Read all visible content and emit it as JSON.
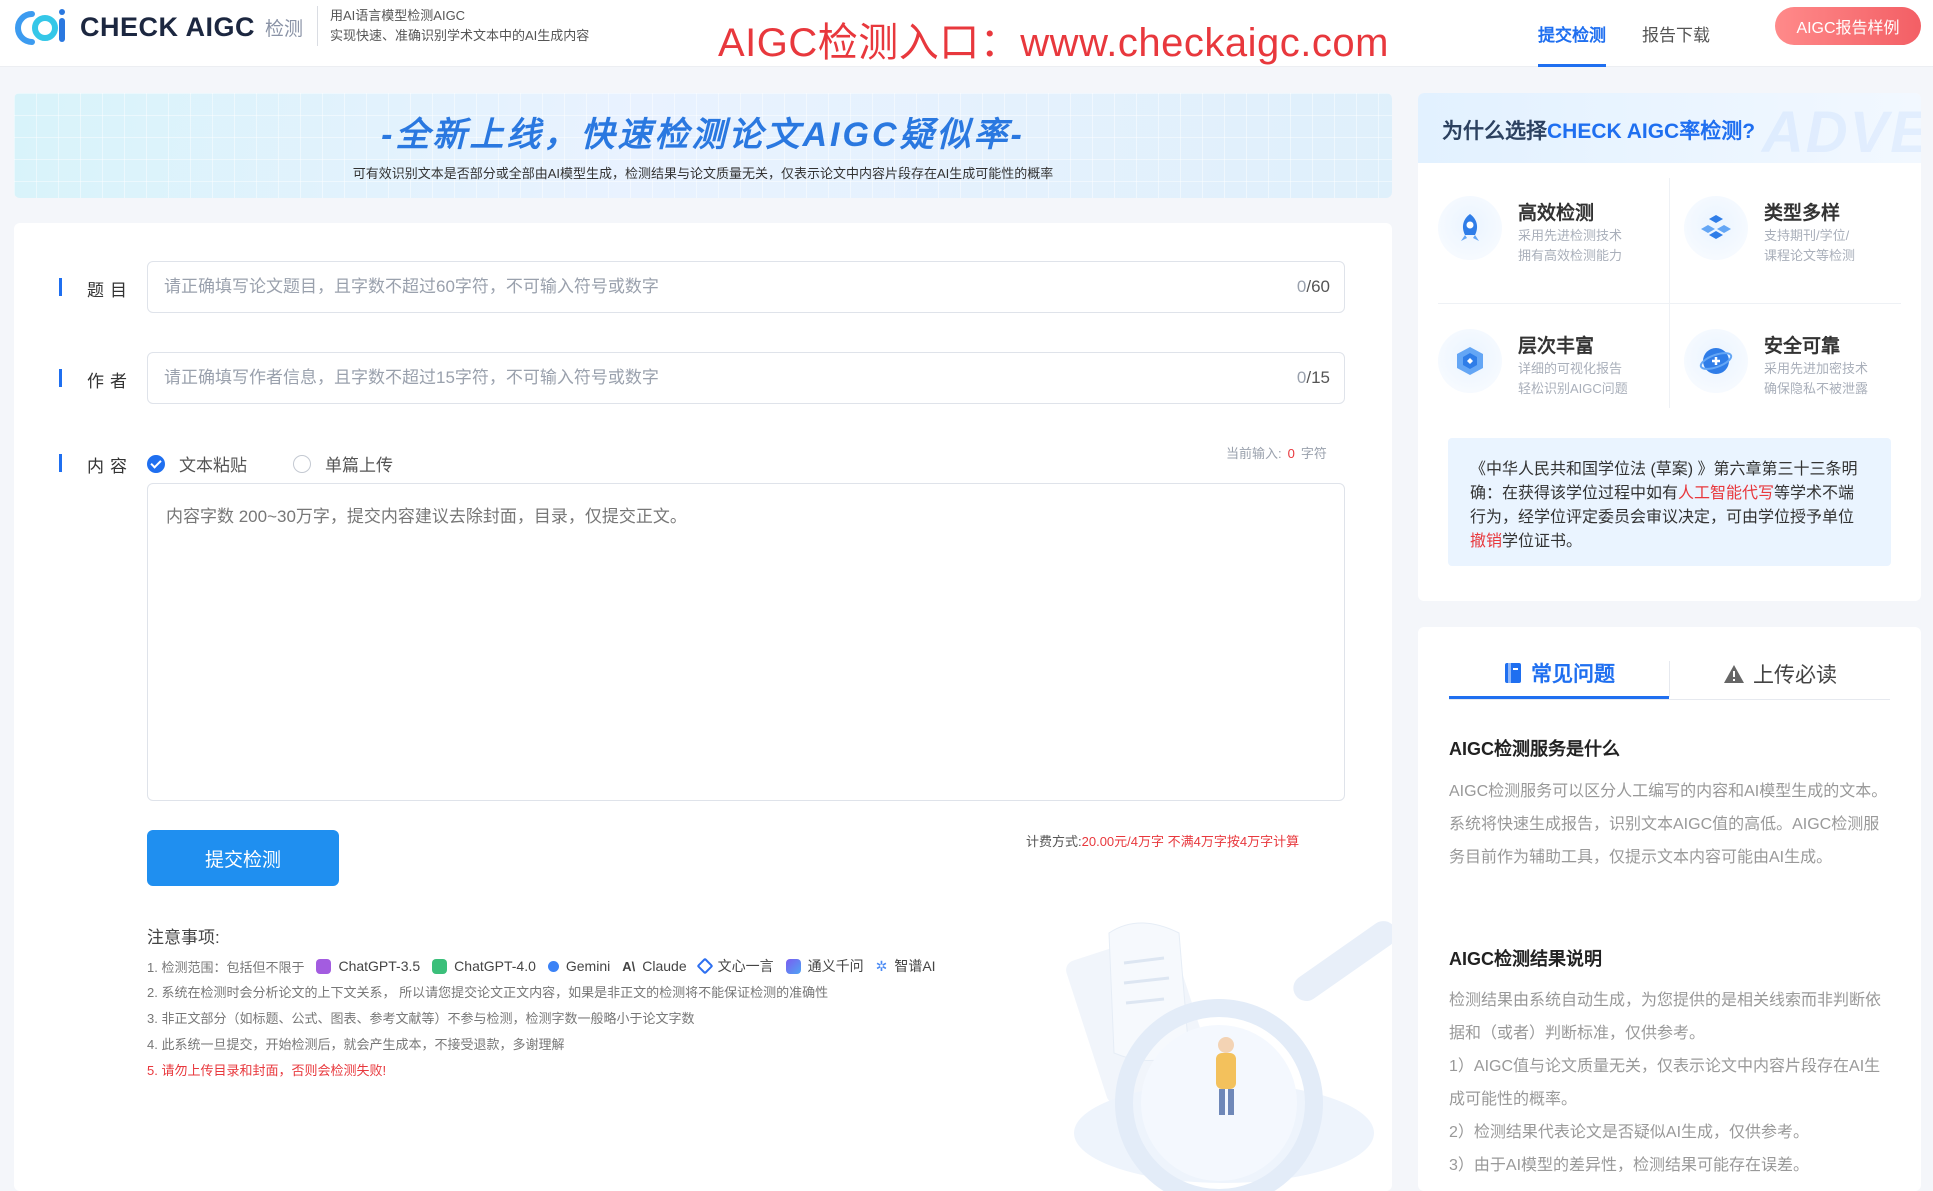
{
  "header": {
    "logo_text": "CHECK AIGC",
    "logo_suffix": "检测",
    "slogan_line1": "用AI语言模型检测AIGC",
    "slogan_line2": "实现快速、准确识别学术文本中的AI生成内容",
    "banner_url": "AIGC检测入口：www.checkaigc.com",
    "nav_submit": "提交检测",
    "nav_report": "报告下载",
    "sample_button": "AIGC报告样例"
  },
  "hero": {
    "title": "-全新上线，快速检测论文AIGC疑似率-",
    "subtitle": "可有效识别文本是否部分或全部由AI模型生成，检测结果与论文质量无关，仅表示论文中内容片段存在AI生成可能性的概率"
  },
  "form": {
    "title_label": "题目",
    "title_placeholder": "请正确填写论文题目，且字数不超过60字符，不可输入符号或数字",
    "title_count": "0",
    "title_max": "/60",
    "author_label": "作者",
    "author_placeholder": "请正确填写作者信息，且字数不超过15字符，不可输入符号或数字",
    "author_count": "0",
    "author_max": "/15",
    "content_label": "内容",
    "radio_paste": "文本粘贴",
    "radio_upload": "单篇上传",
    "current_input_label": "当前输入:",
    "current_input_count": "0",
    "current_input_unit": "字符",
    "content_placeholder": "内容字数 200~30万字，提交内容建议去除封面，目录，仅提交正文。",
    "submit_label": "提交检测",
    "pricing_label": "计费方式:",
    "pricing_value": "20.00元/4万字 不满4万字按4万字计算"
  },
  "notes": {
    "title": "注意事项:",
    "item1_prefix": "1. 检测范围：包括但不限于",
    "models": [
      {
        "name": "ChatGPT-3.5",
        "color": "#a35ce0"
      },
      {
        "name": "ChatGPT-4.0",
        "color": "#3bbf7a"
      },
      {
        "name": "Gemini",
        "color": "#3b82f6"
      },
      {
        "name": "Claude",
        "color": "#222222"
      },
      {
        "name": "文心一言",
        "color": "#2d6ff0"
      },
      {
        "name": "通义千问",
        "color": "#7b5cf0"
      },
      {
        "name": "智谱AI",
        "color": "#4a8af4"
      }
    ],
    "item2": "2. 系统在检测时会分析论文的上下文关系， 所以请您提交论文正文内容，如果是非正文的检测将不能保证检测的准确性",
    "item3": "3. 非正文部分（如标题、公式、图表、参考文献等）不参与检测，检测字数一般略小于论文字数",
    "item4": "4. 此系统一旦提交，开始检测后，就会产生成本，不接受退款，多谢理解",
    "item5": "5. 请勿上传目录和封面，否则会检测失败!"
  },
  "why": {
    "title_prefix": "为什么选择",
    "title_brand": "CHECK AIGC率检测?",
    "bg_text": "ADVE",
    "features": [
      {
        "title": "高效检测",
        "desc1": "采用先进检测技术",
        "desc2": "拥有高效检测能力",
        "icon": "rocket-icon"
      },
      {
        "title": "类型多样",
        "desc1": "支持期刊/学位/",
        "desc2": "课程论文等检测",
        "icon": "cubes-icon"
      },
      {
        "title": "层次丰富",
        "desc1": "详细的可视化报告",
        "desc2": "轻松识别AIGC问题",
        "icon": "layers-icon"
      },
      {
        "title": "安全可靠",
        "desc1": "采用先进加密技术",
        "desc2": "确保隐私不被泄露",
        "icon": "shield-icon"
      }
    ],
    "law_part1": "《中华人民共和国学位法 (草案) 》第六章第三十三条明确：在获得该学位过程中如有",
    "law_red1": "人工智能代写",
    "law_part2": "等学术不端行为，经学位评定委员会审议决定，可由学位授予单位",
    "law_red2": "撤销",
    "law_part3": "学位证书。"
  },
  "faq": {
    "tab_faq": "常见问题",
    "tab_upload": "上传必读",
    "q1": "AIGC检测服务是什么",
    "a1": "AIGC检测服务可以区分人工编写的内容和AI模型生成的文本。 系统将快速生成报告，识别文本AIGC值的高低。AIGC检测服务目前作为辅助工具，仅提示文本内容可能由AI生成。",
    "q2": "AIGC检测结果说明",
    "a2_intro": "检测结果由系统自动生成，为您提供的是相关线索而非判断依据和（或者）判断标准，仅供参考。",
    "a2_p1": "1）AIGC值与论文质量无关，仅表示论文中内容片段存在AI生成可能性的概率。",
    "a2_p2": "2）检测结果代表论文是否疑似AI生成，仅供参考。",
    "a2_p3": "3）由于AI模型的差异性，检测结果可能存在误差。"
  }
}
